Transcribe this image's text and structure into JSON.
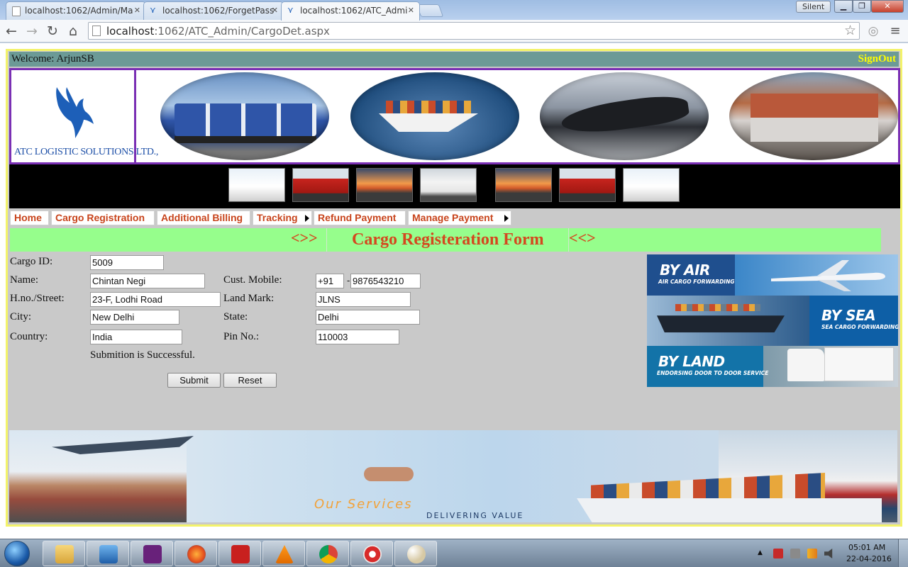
{
  "browser": {
    "tabs": [
      {
        "title": "localhost:1062/Admin/Ma",
        "active": false
      },
      {
        "title": "localhost:1062/ForgetPass",
        "active": false
      },
      {
        "title": "localhost:1062/ATC_Admi",
        "active": true
      }
    ],
    "profile_button": "Silent",
    "url_host": "localhost",
    "url_path": ":1062/ATC_Admin/CargoDet.aspx"
  },
  "header": {
    "welcome": "Welcome: ArjunSB",
    "signout": "SignOut",
    "logo_text": "ATC LOGISTIC SOLUTIONS LTD.,"
  },
  "menu": {
    "items": [
      {
        "label": "Home",
        "has_submenu": false
      },
      {
        "label": "Cargo Registration",
        "has_submenu": false
      },
      {
        "label": "Additional Billing",
        "has_submenu": false
      },
      {
        "label": "Tracking",
        "has_submenu": true
      },
      {
        "label": "Refund Payment",
        "has_submenu": false
      },
      {
        "label": "Manage Payment",
        "has_submenu": true
      }
    ]
  },
  "form": {
    "deco_left": "<>>",
    "title": "Cargo Registeration Form",
    "deco_right": "<<>",
    "labels": {
      "cargo_id": "Cargo ID:",
      "name": "Name:",
      "street": "H.no./Street:",
      "city": "City:",
      "country": "Country:",
      "mobile": "Cust. Mobile:",
      "landmark": "Land Mark:",
      "state": "State:",
      "pin": "Pin No.:"
    },
    "values": {
      "cargo_id": "5009",
      "name": "Chintan Negi",
      "street": "23-F, Lodhi Road",
      "city": "New Delhi",
      "country": "India",
      "mobile_code": "+91",
      "mobile_sep": "-",
      "mobile": "9876543210",
      "landmark": "JLNS",
      "state": "Delhi",
      "pin": "110003"
    },
    "message": "Submition is Successful.",
    "submit_label": "Submit",
    "reset_label": "Reset"
  },
  "side_banner": {
    "air_title": "BY AIR",
    "air_sub": "AIR CARGO FORWARDING",
    "sea_title": "BY SEA",
    "sea_sub": "SEA CARGO FORWARDING",
    "land_title": "BY LAND",
    "land_sub": "ENDORSING DOOR TO DOOR SERVICE"
  },
  "footer": {
    "title": "Our Services",
    "subtitle": "DELIVERING VALUE"
  },
  "taskbar": {
    "time": "05:01 AM",
    "date": "22-04-2016"
  },
  "colors": {
    "accent_orange": "#d4481f",
    "menu_text": "#c8441c",
    "title_bar": "#96fe8c",
    "welcome_bar": "#6c9a96",
    "signout": "#ffff00",
    "banner_border": "#7a2fb4",
    "frame_border": "#f3f36a"
  }
}
